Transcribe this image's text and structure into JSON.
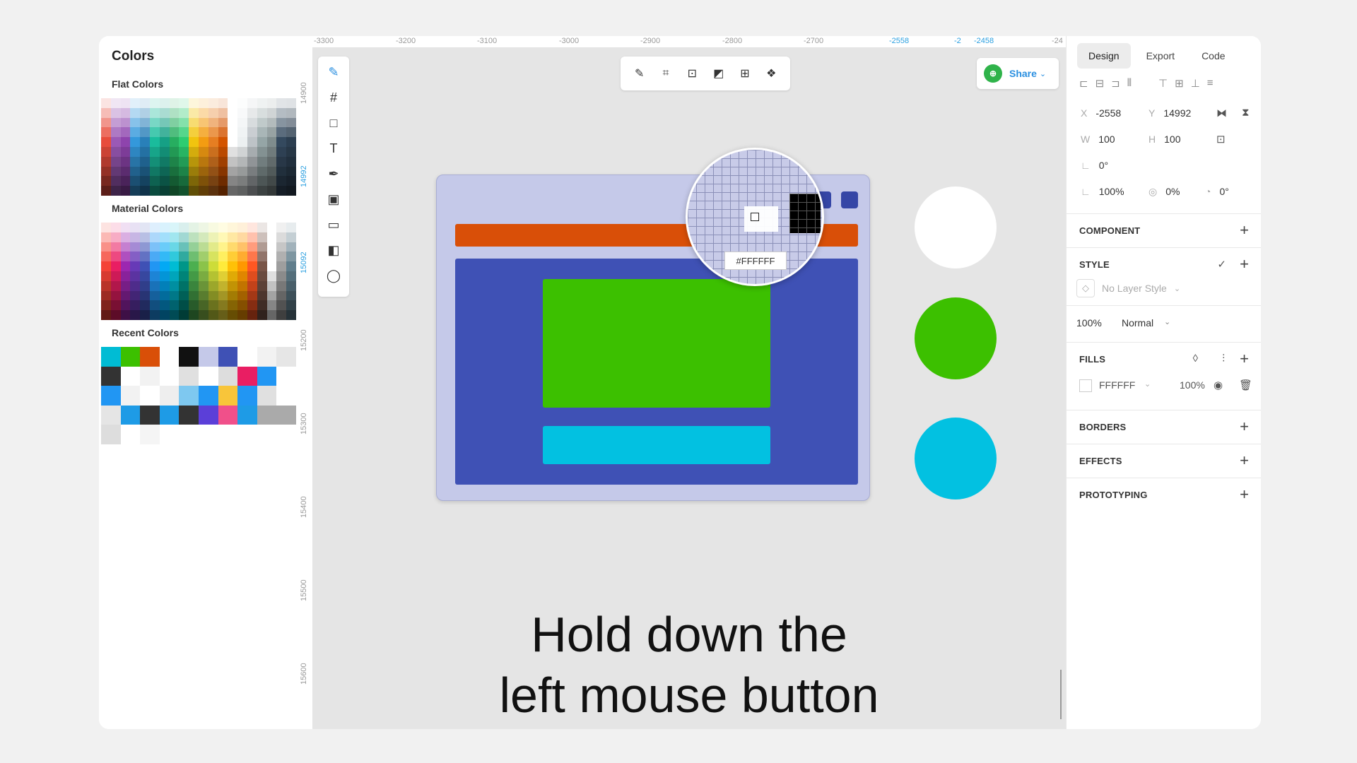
{
  "left_panel": {
    "title": "Colors",
    "sections": {
      "flat": "Flat Colors",
      "material": "Material Colors",
      "recent": "Recent Colors"
    }
  },
  "palettes": {
    "flat_columns": [
      "#e74c3c",
      "#9b59b6",
      "#8e44ad",
      "#3498db",
      "#2980b9",
      "#1abc9c",
      "#16a085",
      "#27ae60",
      "#2ecc71",
      "#f1c40f",
      "#f39c12",
      "#e67e22",
      "#d35400",
      "#ffffff",
      "#ecf0f1",
      "#bdc3c7",
      "#95a5a6",
      "#7f8c8d",
      "#34495e",
      "#2c3e50"
    ],
    "material_columns": [
      "#f44336",
      "#e91e63",
      "#9c27b0",
      "#673ab7",
      "#3f51b5",
      "#2196f3",
      "#03a9f4",
      "#00bcd4",
      "#009688",
      "#4caf50",
      "#8bc34a",
      "#cddc39",
      "#ffeb3b",
      "#ffc107",
      "#ff9800",
      "#ff5722",
      "#795548",
      "#ffffff",
      "#9e9e9e",
      "#607d8b"
    ],
    "recent": [
      "#00bcd4",
      "#3cc000",
      "#d94f08",
      "#ffffff",
      "#111111",
      "#c5c9e9",
      "#3f51b5",
      "#ffffff",
      "#f2f2f2",
      "#e6e6e6",
      "#333333",
      "#ffffff",
      "#f2f2f2",
      "#ffffff",
      "#e0e0e0",
      "#ffffff",
      "#dddddd",
      "#e91e63",
      "#2196f3",
      "#ffffff",
      "#2196f3",
      "#f2f2f2",
      "#ffffff",
      "#eeeeee",
      "#7ec8f0",
      "#2196f3",
      "#f8c53a",
      "#2196f3",
      "#e0e0e0",
      "#ffffff",
      "#e5e5e5",
      "#1e9be6",
      "#333333",
      "#1e9be6",
      "#333333",
      "#5b3fd8",
      "#f0508a",
      "#1e9be6",
      "#aaaaaa",
      "#aaaaaa",
      "#dddddd",
      "#ffffff",
      "#f5f5f5"
    ]
  },
  "ruler": {
    "top": [
      "-3300",
      "-3200",
      "-3100",
      "-3000",
      "-2900",
      "-2800",
      "-2700",
      "-2558",
      "-2",
      "-2458",
      "-24"
    ],
    "left": [
      "14900",
      "14992",
      "15092",
      "15200",
      "15300",
      "15400",
      "15500",
      "15600"
    ]
  },
  "canvas": {
    "picker_hex": "#FFFFFF",
    "caption_line1": "Hold down the",
    "caption_line2": "left mouse button",
    "share_label": "Share",
    "colors": {
      "frame": "#c5c9e9",
      "orange": "#d94f08",
      "blue": "#3f51b5",
      "green": "#3cc000",
      "cyan": "#02c1e1",
      "white": "#ffffff"
    }
  },
  "right_panel": {
    "tabs": [
      "Design",
      "Export",
      "Code"
    ],
    "x_label": "X",
    "x_value": "-2558",
    "y_label": "Y",
    "y_value": "14992",
    "w_label": "W",
    "w_value": "100",
    "h_label": "H",
    "h_value": "100",
    "rotation": "0°",
    "opacity": "100%",
    "corner": "0%",
    "skew": "0°",
    "component": "COMPONENT",
    "style": "STYLE",
    "no_layer_style": "No Layer Style",
    "layer_opacity": "100%",
    "blend": "Normal",
    "fills": "FILLS",
    "fill_hex": "FFFFFF",
    "fill_opacity": "100%",
    "borders": "BORDERS",
    "effects": "EFFECTS",
    "prototyping": "PROTOTYPING"
  }
}
